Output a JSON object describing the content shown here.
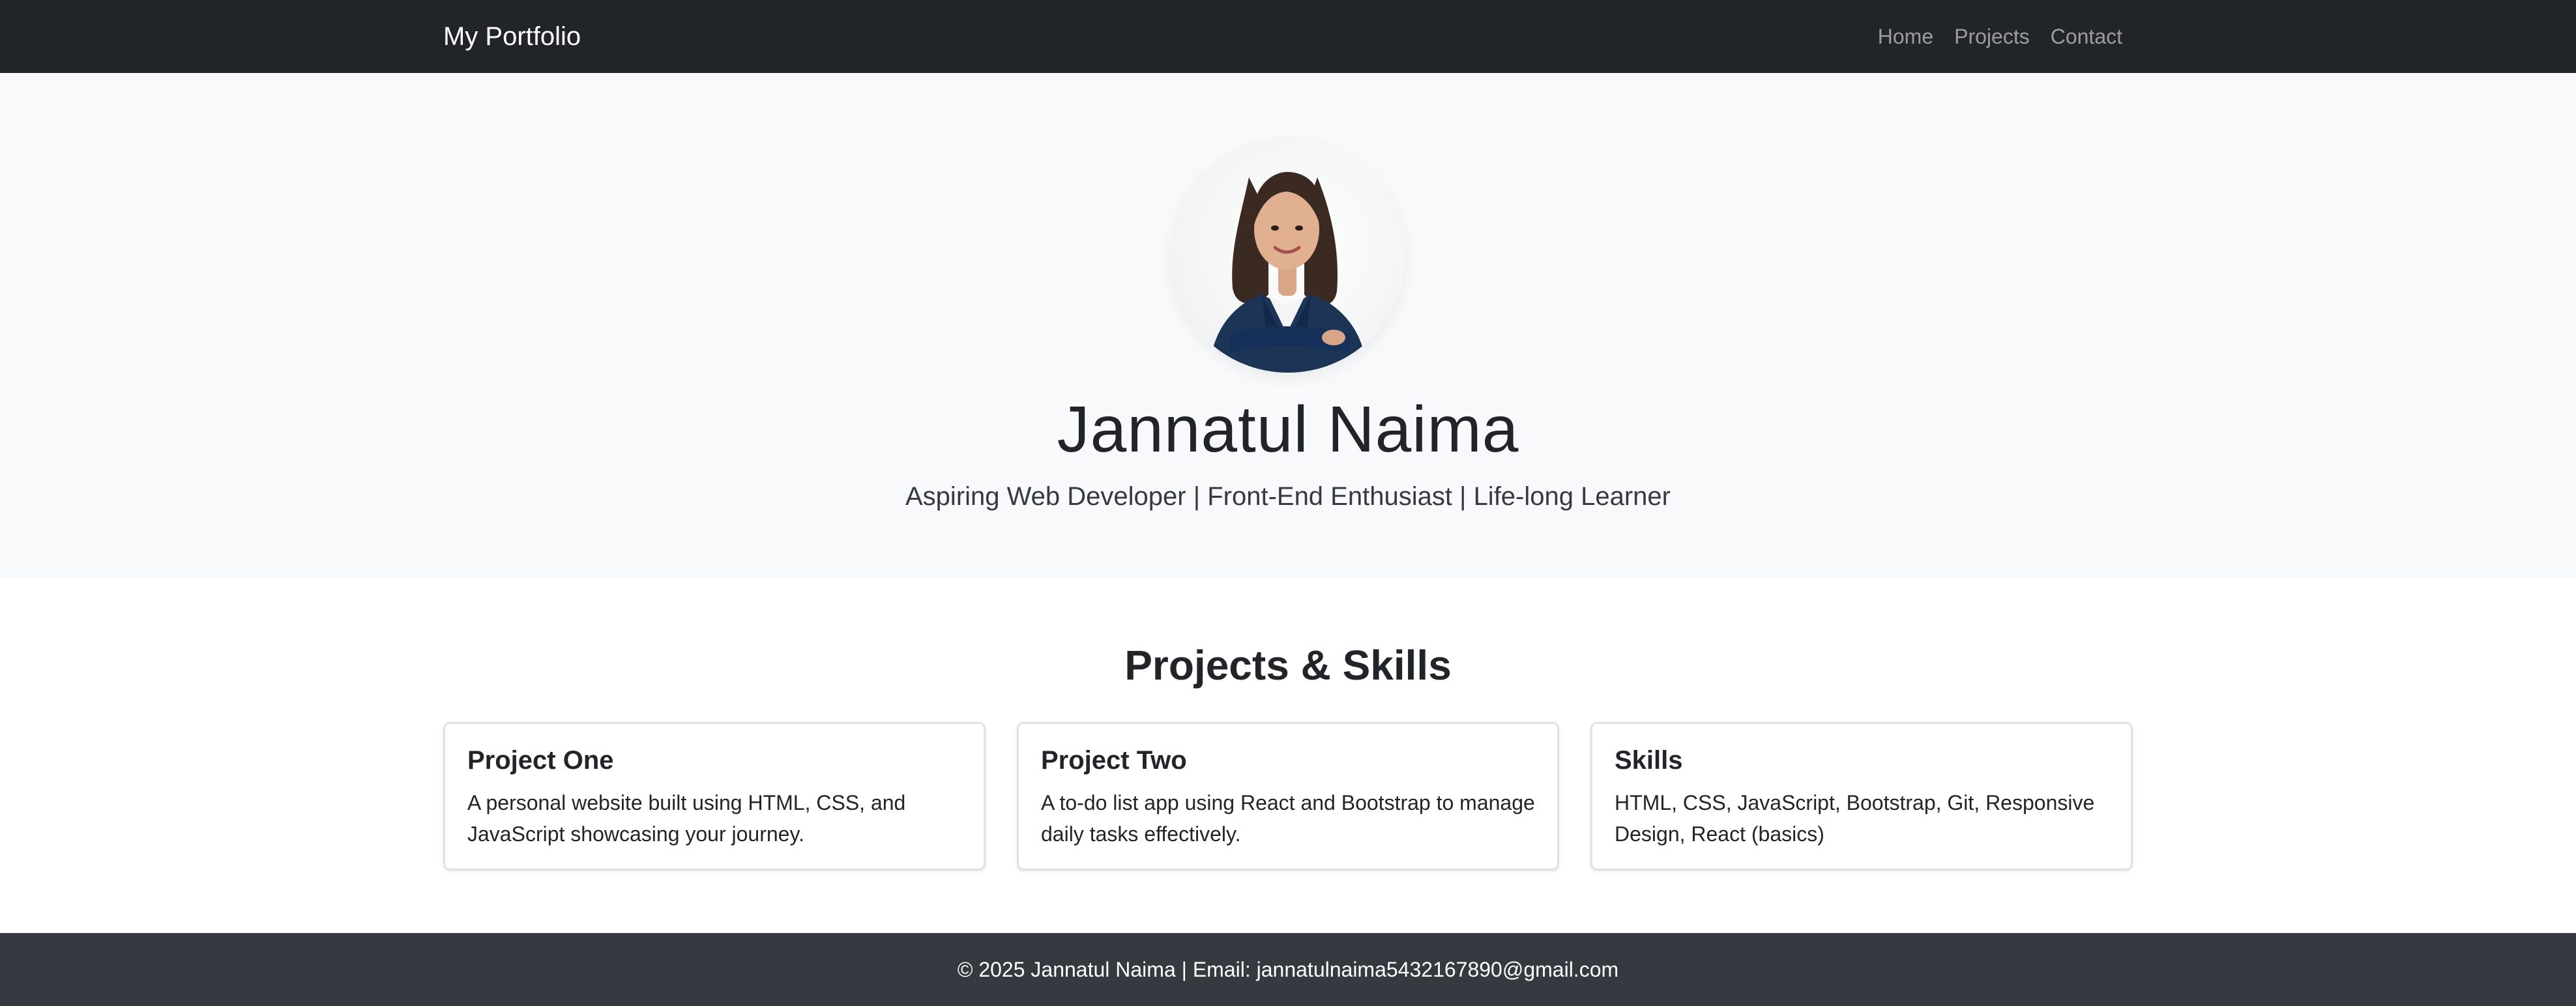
{
  "navbar": {
    "brand": "My Portfolio",
    "links": [
      "Home",
      "Projects",
      "Contact"
    ]
  },
  "hero": {
    "avatar_icon": "profile-photo",
    "name": "Jannatul Naima",
    "tagline": "Aspiring Web Developer | Front-End Enthusiast | Life-long Learner"
  },
  "projects": {
    "title": "Projects & Skills",
    "cards": [
      {
        "title": "Project One",
        "text": "A personal website built using HTML, CSS, and JavaScript showcasing your journey."
      },
      {
        "title": "Project Two",
        "text": "A to-do list app using React and Bootstrap to manage daily tasks effectively."
      },
      {
        "title": "Skills",
        "text": "HTML, CSS, JavaScript, Bootstrap, Git, Responsive Design, React (basics)"
      }
    ]
  },
  "footer": {
    "text": "© 2025 Jannatul Naima | Email: jannatulnaima5432167890@gmail.com"
  },
  "colors": {
    "navbar_bg": "#212529",
    "hero_bg": "#f8f9fa",
    "footer_bg": "#343a40",
    "suit": "#1c3557"
  }
}
